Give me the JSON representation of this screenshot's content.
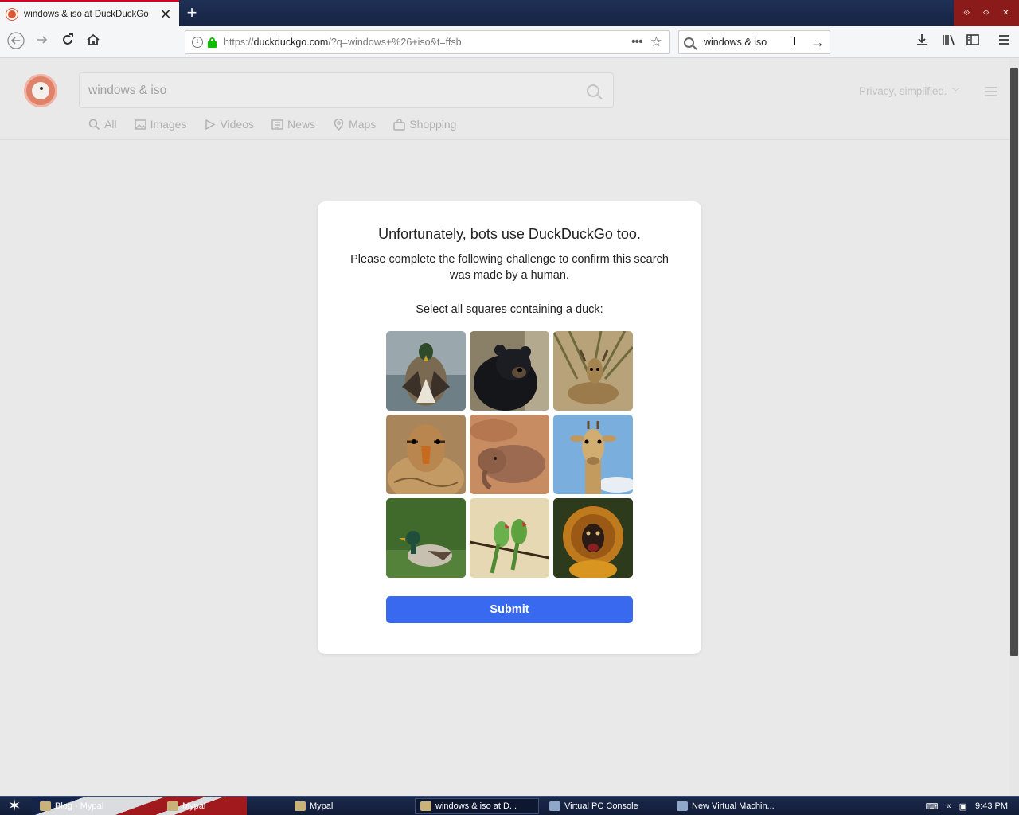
{
  "browser": {
    "tab": {
      "title": "windows & iso at DuckDuckGo",
      "close": "✕"
    },
    "new_tab": "+",
    "url": {
      "prefix": "https://",
      "host": "duckduckgo.com",
      "path": "/?q=windows+%26+iso&t=ffsb"
    },
    "search_box": {
      "value": "windows & iso"
    },
    "window_controls": [
      "⟐",
      "⟐",
      "✕"
    ]
  },
  "ddg": {
    "search": {
      "value": "windows & iso"
    },
    "privacy": "Privacy, simplified.",
    "nav": [
      {
        "icon": "search-icon",
        "label": "All"
      },
      {
        "icon": "images-icon",
        "label": "Images"
      },
      {
        "icon": "videos-icon",
        "label": "Videos"
      },
      {
        "icon": "news-icon",
        "label": "News"
      },
      {
        "icon": "maps-icon",
        "label": "Maps"
      },
      {
        "icon": "shopping-icon",
        "label": "Shopping"
      }
    ]
  },
  "challenge": {
    "title": "Unfortunately, bots use DuckDuckGo too.",
    "subtitle": "Please complete the following challenge to confirm this search was made by a human.",
    "prompt": "Select all squares containing a duck:",
    "tiles": [
      "duck",
      "bear",
      "deer",
      "duck",
      "elephant",
      "giraffe",
      "duck",
      "parrots",
      "monkey"
    ],
    "submit": "Submit"
  },
  "taskbar": {
    "items": [
      {
        "label": "Blog - Mypal"
      },
      {
        "label": "Mypal"
      },
      {
        "label": "Mypal"
      },
      {
        "label": "windows & iso at D..."
      },
      {
        "label": "Virtual PC Console"
      },
      {
        "label": "New Virtual Machin..."
      }
    ],
    "clock": "9:43 PM"
  },
  "colors": {
    "accent": "#3969ef",
    "ddg_orange": "#de5833",
    "tab_accent": "#d70022"
  }
}
